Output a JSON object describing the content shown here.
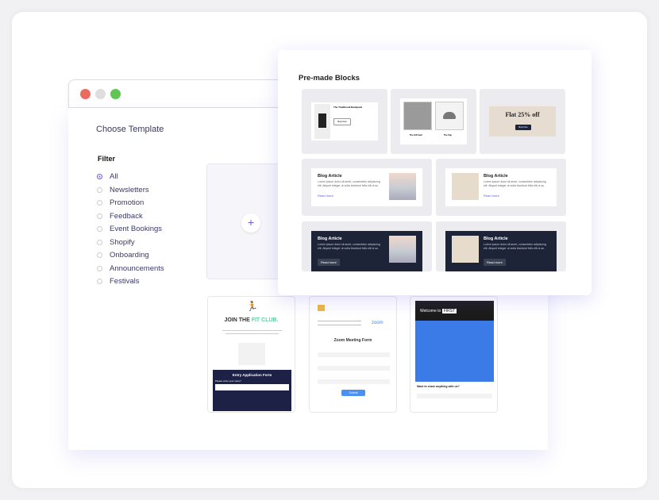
{
  "window": {
    "controls": {
      "close": "#ec6a5e",
      "minimize": "#dedede",
      "maximize": "#61c554"
    }
  },
  "main": {
    "title": "Choose Template",
    "filter_label": "Filter",
    "plus": "+"
  },
  "filters": [
    {
      "label": "All",
      "selected": true
    },
    {
      "label": "Newsletters"
    },
    {
      "label": "Promotion"
    },
    {
      "label": "Feedback"
    },
    {
      "label": "Event Bookings"
    },
    {
      "label": "Shopify"
    },
    {
      "label": "Onboarding"
    },
    {
      "label": "Announcements"
    },
    {
      "label": "Festivals"
    }
  ],
  "templates": {
    "fit": {
      "title_a": "JOIN THE ",
      "title_b": "FIT CLUB.",
      "form_title": "Entry Application Form",
      "field": "Please enter your name*"
    },
    "zoom": {
      "brand": "zoom",
      "form_title": "Zoom Meeting Form",
      "submit": "Submit"
    },
    "first": {
      "welcome": "Welcome to ",
      "brand": "FIRST",
      "question": "Want to share anything with us?"
    }
  },
  "blocks": {
    "title": "Pre-made Blocks",
    "product": "The Traditional Backpack",
    "product_btn": "Shop Now",
    "gift1": "The Gift Card",
    "gift2": "The Cap",
    "promo": "Flat 25% off",
    "promo_btn": "Shop Now",
    "blog_title": "Blog Article",
    "blog_text": "Lorem ipsum dolor sit amet, consectetur adipiscing elit. Aliquet integer ut nulla tincidunt felis elit ut ac.",
    "read_more": "Read more"
  }
}
